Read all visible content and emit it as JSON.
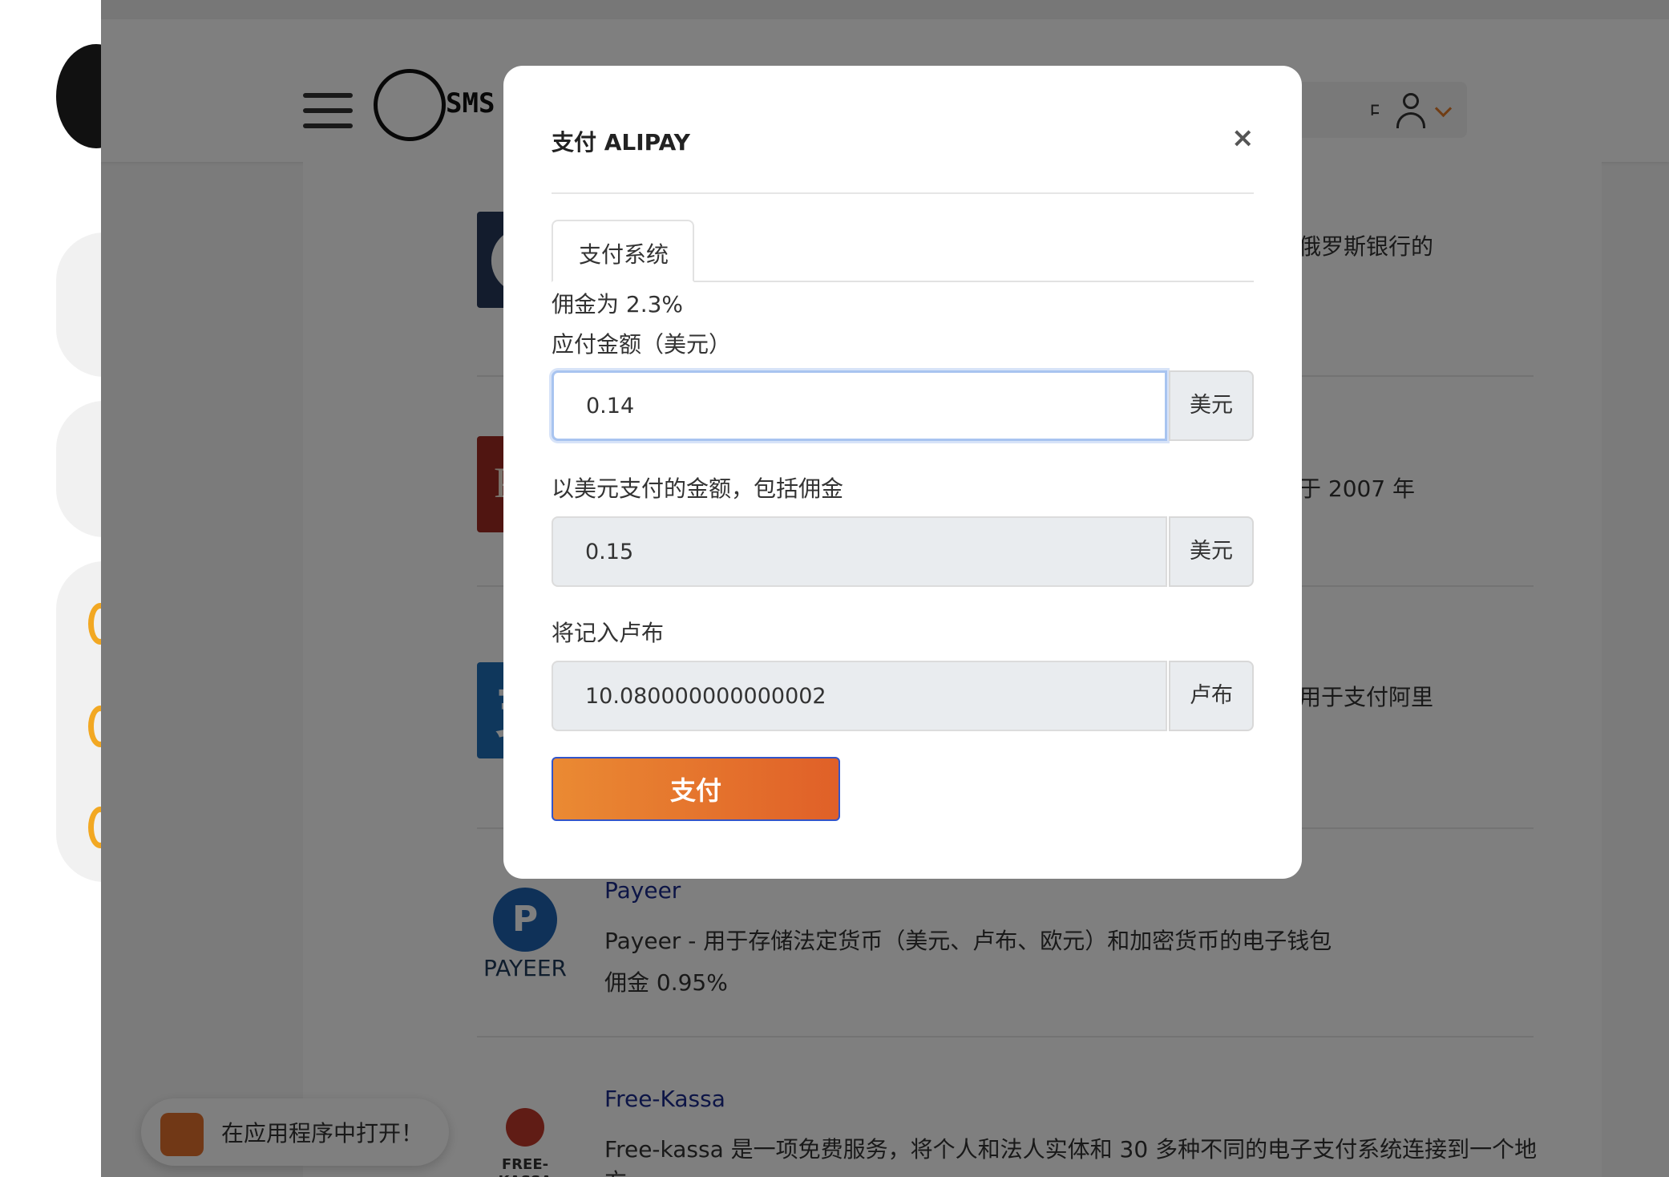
{
  "app": {
    "brand_text": "SMS ACTIVATE",
    "language_label": "中國"
  },
  "payment_list": {
    "right_snippets": [
      "俄罗斯银行的",
      "于 2007 年",
      "用于支付阿里"
    ],
    "items": [
      {
        "title": "Payeer",
        "description": "Payeer - 用于存储法定货币（美元、卢布、欧元）和加密货币的电子钱包",
        "commission": "佣金 0.95%",
        "logo_text": "PAYEER"
      },
      {
        "title": "Free-Kassa",
        "description": "Free-kassa 是一项免费服务，将个人和法人实体和 30 多种不同的电子支付系统连接到一个地",
        "description_2": "方",
        "logo_text": "FREE-KASSA"
      }
    ]
  },
  "open_in_app": "在应用程序中打开！",
  "modal": {
    "title": "支付 ALIPAY",
    "tab": "支付系统",
    "commission_text": "佣金为 2.3%",
    "amount_label": "应付金额（美元）",
    "amount_value": "0.14",
    "amount_unit": "美元",
    "total_label": "以美元支付的金额，包括佣金",
    "total_value": "0.15",
    "total_unit": "美元",
    "credit_label": "将记入卢布",
    "credit_value": "10.080000000000002",
    "credit_unit": "卢布",
    "pay_button": "支付"
  },
  "colors": {
    "accent": "#e2702c",
    "link": "#1a2a8c"
  }
}
